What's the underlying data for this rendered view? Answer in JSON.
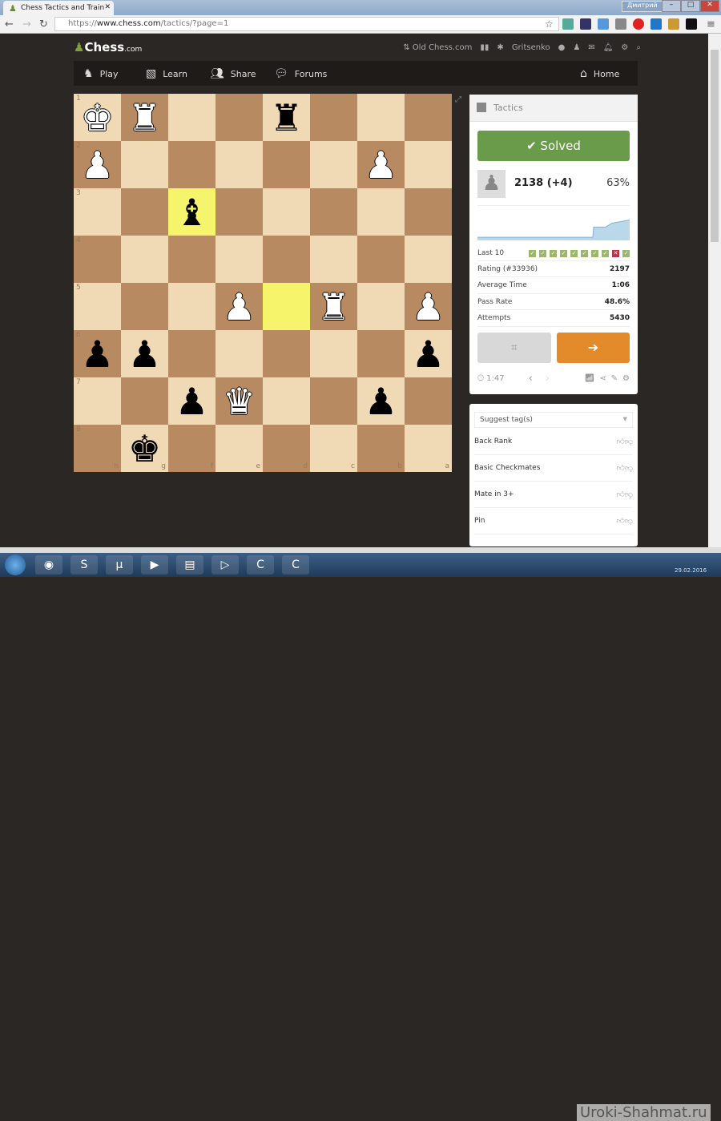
{
  "browser": {
    "tab_title": "Chess Tactics and Train",
    "url_prefix": "https://",
    "url_domain": "www.chess.com",
    "url_path": "/tactics/?page=1",
    "user": "Дмитрий"
  },
  "site": {
    "logo": "Chess",
    "logo_suffix": ".com",
    "top_links": {
      "old": "Old Chess.com",
      "username": "Gritsenko"
    },
    "nav": [
      {
        "label": "Play",
        "icon": "play-icon"
      },
      {
        "label": "Learn",
        "icon": "learn-icon"
      },
      {
        "label": "Share",
        "icon": "share-icon"
      },
      {
        "label": "Forums",
        "icon": "forums-icon"
      }
    ],
    "home": "Home"
  },
  "board": {
    "orientation": "black",
    "light": "#f0dab5",
    "dark": "#b78a62",
    "highlight": "#f6f46a",
    "rank_labels": [
      "1",
      "2",
      "3",
      "4",
      "5",
      "6",
      "7",
      "8"
    ],
    "file_labels": [
      "h",
      "g",
      "f",
      "e",
      "d",
      "c",
      "b",
      "a"
    ],
    "highlights": [
      "f3",
      "d5"
    ],
    "pieces": [
      {
        "sq": "h1",
        "p": "♚",
        "c": "w"
      },
      {
        "sq": "g1",
        "p": "♜",
        "c": "w"
      },
      {
        "sq": "d1",
        "p": "♜",
        "c": "b"
      },
      {
        "sq": "h2",
        "p": "♟",
        "c": "w"
      },
      {
        "sq": "b2",
        "p": "♟",
        "c": "w"
      },
      {
        "sq": "f3",
        "p": "♝",
        "c": "b"
      },
      {
        "sq": "e5",
        "p": "♟",
        "c": "w"
      },
      {
        "sq": "c5",
        "p": "♜",
        "c": "w"
      },
      {
        "sq": "a5",
        "p": "♟",
        "c": "w"
      },
      {
        "sq": "h6",
        "p": "♟",
        "c": "b"
      },
      {
        "sq": "g6",
        "p": "♟",
        "c": "b"
      },
      {
        "sq": "a6",
        "p": "♟",
        "c": "b"
      },
      {
        "sq": "f7",
        "p": "♟",
        "c": "b"
      },
      {
        "sq": "e7",
        "p": "♛",
        "c": "w"
      },
      {
        "sq": "b7",
        "p": "♟",
        "c": "b"
      },
      {
        "sq": "g8",
        "p": "♚",
        "c": "b"
      }
    ]
  },
  "tactics": {
    "title": "Tactics",
    "status": "Solved",
    "rating": "2138 (+4)",
    "percent": "63%",
    "last10_label": "Last 10",
    "last10": [
      true,
      true,
      true,
      true,
      true,
      true,
      true,
      true,
      false,
      true
    ],
    "stats": [
      {
        "label": "Rating (#33936)",
        "value": "2197"
      },
      {
        "label": "Average Time",
        "value": "1:06"
      },
      {
        "label": "Pass Rate",
        "value": "48.6%"
      },
      {
        "label": "Attempts",
        "value": "5430"
      }
    ],
    "timer": "1:47",
    "colors": {
      "solved": "#699b4a",
      "next": "#e38b2a",
      "fail": "#b3364a"
    }
  },
  "tags": {
    "placeholder": "Suggest tag(s)",
    "items": [
      "Back Rank",
      "Basic Checkmates",
      "Mate in 3+",
      "Pin"
    ]
  },
  "taskbar": {
    "watermark": "Uroki-Shahmat.ru",
    "date": "29.02.2016"
  }
}
